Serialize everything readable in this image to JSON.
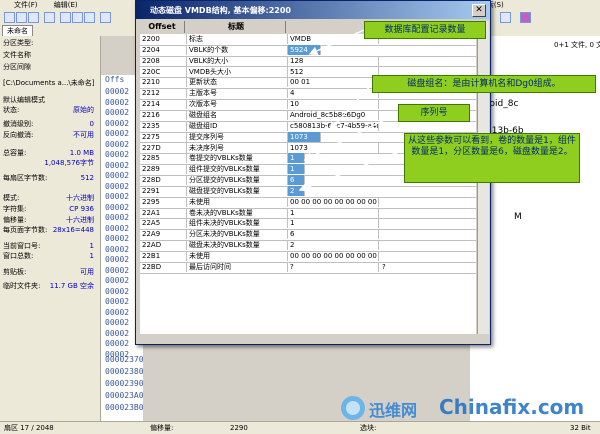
{
  "dialog": {
    "title": "动态磁盘  VMDB结构, 基本偏移:2200",
    "columns": [
      "Offset",
      "标题",
      "数值"
    ],
    "rows": [
      {
        "off": "2200",
        "label": "标志",
        "v1": "VMDB",
        "v2": "",
        "hl": false
      },
      {
        "off": "2204",
        "label": "VBLK的个数",
        "v1": "5924",
        "v2": "",
        "hl": true
      },
      {
        "off": "2208",
        "label": "VBLK的大小",
        "v1": "128",
        "v2": "",
        "hl": false
      },
      {
        "off": "220C",
        "label": "VMDB头大小",
        "v1": "512",
        "v2": "",
        "hl": false
      },
      {
        "off": "2210",
        "label": "更新状态",
        "v1": "00 01",
        "v2": "",
        "hl": false
      },
      {
        "off": "2212",
        "label": "主版本号",
        "v1": "4",
        "v2": "",
        "hl": false
      },
      {
        "off": "2214",
        "label": "次版本号",
        "v1": "10",
        "v2": "",
        "hl": false
      },
      {
        "off": "2216",
        "label": "磁盘组名",
        "v1": "Android_8c5b8e6Dg0",
        "v2": "",
        "hl": false
      },
      {
        "off": "2235",
        "label": "磁盘组ID",
        "v1": "c580813b-6bc7-4b59-a4d4-9c4534a22a",
        "v2": "",
        "hl": false
      },
      {
        "off": "2275",
        "label": "提交序列号",
        "v1": "1073",
        "v2": "",
        "hl": true
      },
      {
        "off": "227D",
        "label": "未决序列号",
        "v1": "1073",
        "v2": "",
        "hl": false
      },
      {
        "off": "2285",
        "label": "卷提交的VBLKs数量",
        "v1": "1",
        "v2": "",
        "hl": true
      },
      {
        "off": "2289",
        "label": "组件提交的VBLKs数量",
        "v1": "1",
        "v2": "",
        "hl": true
      },
      {
        "off": "228D",
        "label": "分区提交的VBLKs数量",
        "v1": "6",
        "v2": "",
        "hl": true
      },
      {
        "off": "2291",
        "label": "磁盘提交的VBLKs数量",
        "v1": "2",
        "v2": "",
        "hl": true
      },
      {
        "off": "2295",
        "label": "未使用",
        "v1": "00 00 00 00 00 00 00 00 00 00 00",
        "v2": "",
        "hl": false
      },
      {
        "off": "22A1",
        "label": "卷未决的VBLKs数量",
        "v1": "1",
        "v2": "",
        "hl": false
      },
      {
        "off": "22A5",
        "label": "组件未决的VBLKs数量",
        "v1": "1",
        "v2": "",
        "hl": false
      },
      {
        "off": "22A9",
        "label": "分区未决的VBLKs数量",
        "v1": "6",
        "v2": "",
        "hl": false
      },
      {
        "off": "22AD",
        "label": "磁盘未决的VBLKs数量",
        "v1": "2",
        "v2": "",
        "hl": false
      },
      {
        "off": "22B1",
        "label": "未使用",
        "v1": "00 00 00 00 00 00 00 00 00 00 00",
        "v2": "",
        "hl": false
      },
      {
        "off": "22BD",
        "label": "最后访问时间",
        "v1": "?",
        "v2": "?",
        "hl": false
      }
    ]
  },
  "callouts": {
    "c1": "数据库配置记录数量",
    "c2": "磁盘组名：是由计算机名和Dg0组成。",
    "c3": "序列号",
    "c4": "从这些参数可以看到，卷的数量是1，组件数量是1，分区数量是6，磁盘数量是2。"
  },
  "app": {
    "menu": [
      "文件(F)",
      "编辑(E)",
      "搜索(S)",
      "位置(P)",
      "查看(V)",
      "工具(T)",
      "专业工具"
    ],
    "tab": "未命名",
    "left": [
      {
        "l": "分区类型:",
        "v": ""
      },
      {
        "l": "文件名称",
        "v": ""
      },
      {
        "l": "分区间隙",
        "v": ""
      },
      {
        "l": "[C:\\Documents a...\\未命名]",
        "v": ""
      },
      {
        "l": "默认编辑模式",
        "v": ""
      },
      {
        "l": "状态:",
        "v": "原始的"
      },
      {
        "l": "撤消级别:",
        "v": "0"
      },
      {
        "l": "反向撤消:",
        "v": "不可用"
      },
      {
        "l": "总容量:",
        "v": "1.0 MB"
      },
      {
        "l": "",
        "v": "1,048,576字节"
      },
      {
        "l": "每扇区字节数:",
        "v": "512"
      },
      {
        "l": "模式:",
        "v": "十六进制"
      },
      {
        "l": "字符集:",
        "v": "CP 936"
      },
      {
        "l": "偏移量:",
        "v": "十六进制"
      },
      {
        "l": "每页面字节数:",
        "v": "28x16=448"
      },
      {
        "l": "当前窗口号:",
        "v": "1"
      },
      {
        "l": "窗口总数:",
        "v": "1"
      },
      {
        "l": "剪贴板:",
        "v": "可用"
      },
      {
        "l": "临时文件夹:",
        "v": "11.7 GB 空余"
      }
    ],
    "hex_header": "Offs",
    "hex_rows": [
      "00002370",
      "00002380",
      "00002390",
      "000023A0",
      "000023B0"
    ],
    "hex_top_rows": [
      "00002",
      "00002",
      "00002",
      "00002",
      "00002",
      "00002",
      "00002",
      "00002",
      "00002",
      "00002",
      "00002",
      "00002",
      "00002",
      "00002",
      "00002",
      "00002",
      "00002",
      "00002",
      "00002",
      "00002",
      "00002",
      "00002",
      "00002",
      "00002",
      "00002",
      "00002"
    ],
    "right_texts": [
      "0+1 文件, 0 文",
      "roid_8c",
      "813b-6b",
      "M"
    ],
    "status": {
      "sector": "扇区 17 / 2048",
      "offset_label": "偏移量:",
      "offset_val": "2290",
      "sel_label": "选块:",
      "right": "32 Bit"
    },
    "watermark": "Chinafix.com",
    "watermark_cn": "迅维网"
  }
}
